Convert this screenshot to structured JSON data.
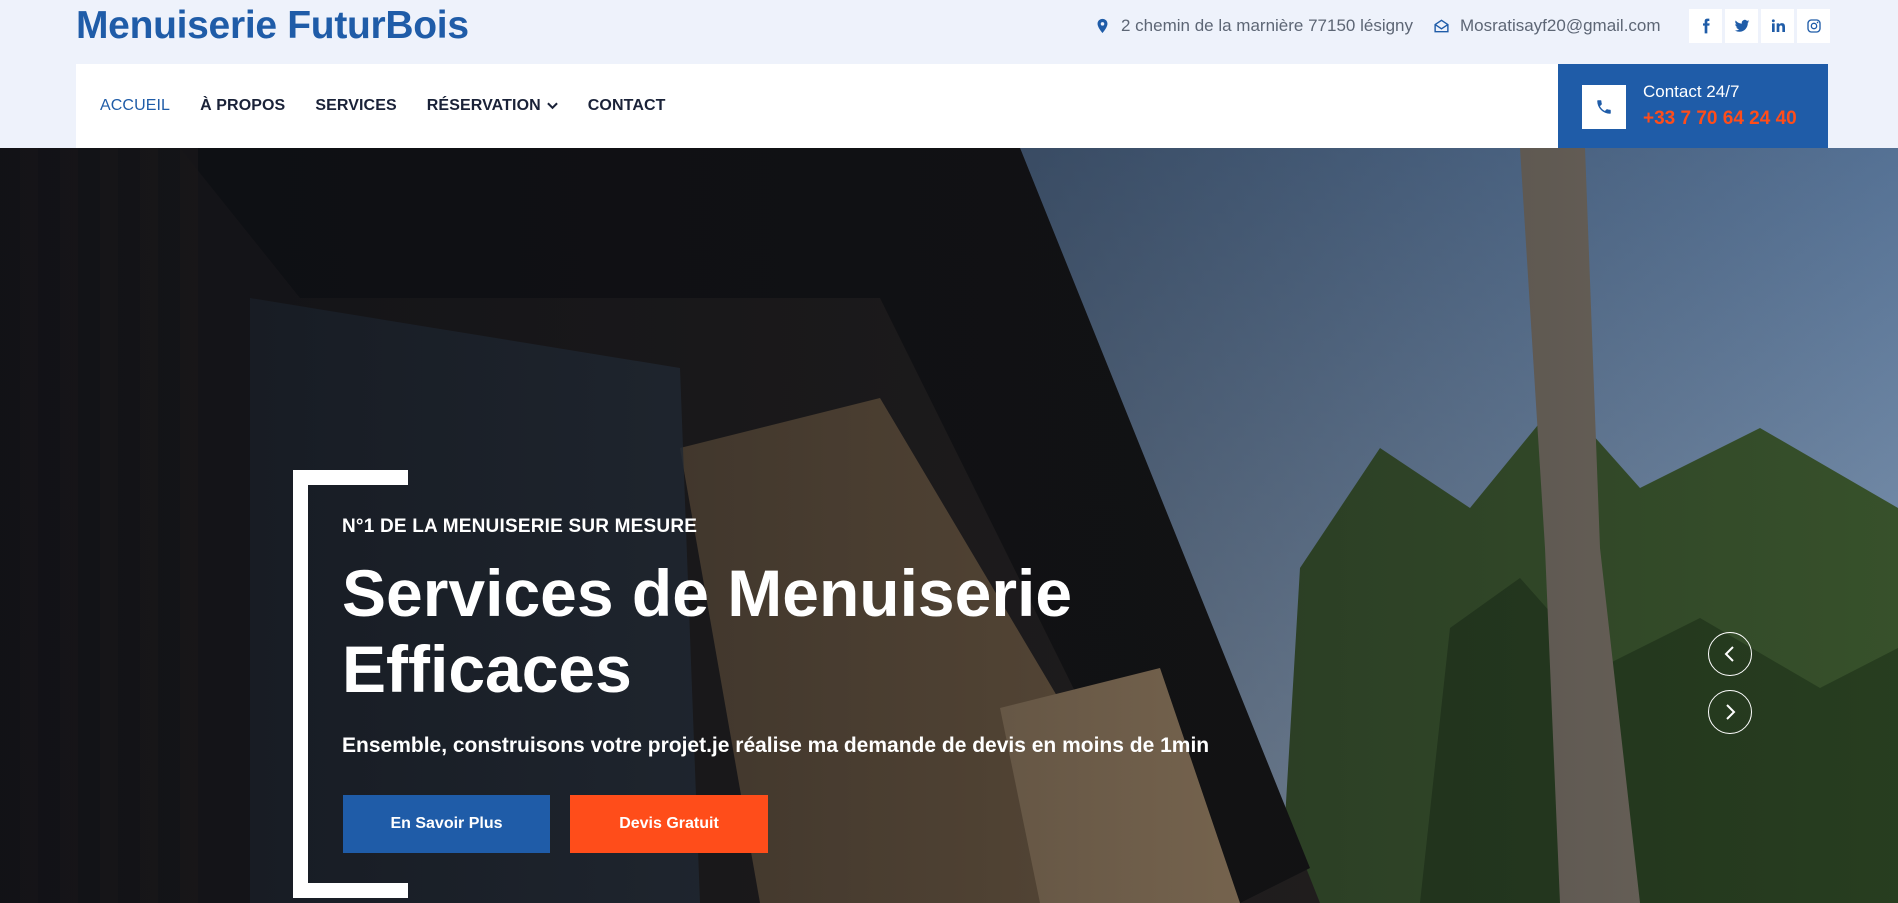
{
  "brand": {
    "name": "Menuiserie FuturBois"
  },
  "topbar": {
    "address": "2 chemin de la marnière 77150 lésigny",
    "email": "Mosratisayf20@gmail.com",
    "address_icon": "map-pin-icon",
    "email_icon": "envelope-open-icon",
    "socials": [
      {
        "name": "facebook",
        "icon": "facebook-icon"
      },
      {
        "name": "twitter",
        "icon": "twitter-icon"
      },
      {
        "name": "linkedin",
        "icon": "linkedin-icon"
      },
      {
        "name": "instagram",
        "icon": "instagram-icon"
      }
    ]
  },
  "nav": {
    "items": [
      {
        "label": "ACCUEIL",
        "active": true
      },
      {
        "label": "À PROPOS",
        "active": false
      },
      {
        "label": "SERVICES",
        "active": false
      },
      {
        "label": "RÉSERVATION",
        "active": false,
        "dropdown": true
      },
      {
        "label": "CONTACT",
        "active": false
      }
    ]
  },
  "contact": {
    "label": "Contact 24/7",
    "phone": "+33 7 70 64 24 40",
    "icon": "phone-icon"
  },
  "hero": {
    "subtitle": "N°1 DE LA MENUISERIE SUR MESURE",
    "headline_line1": "Services de Menuiserie",
    "headline_line2": "Efficaces",
    "tagline": "Ensemble, construisons votre projet.je réalise ma demande de devis en moins de 1min",
    "primary_button": "En Savoir Plus",
    "secondary_button": "Devis Gratuit"
  },
  "colors": {
    "brand_blue": "#1f5ca8",
    "accent_orange": "#ff4d1a",
    "topbar_bg": "#eef2fb",
    "nav_text": "#1a2238"
  }
}
